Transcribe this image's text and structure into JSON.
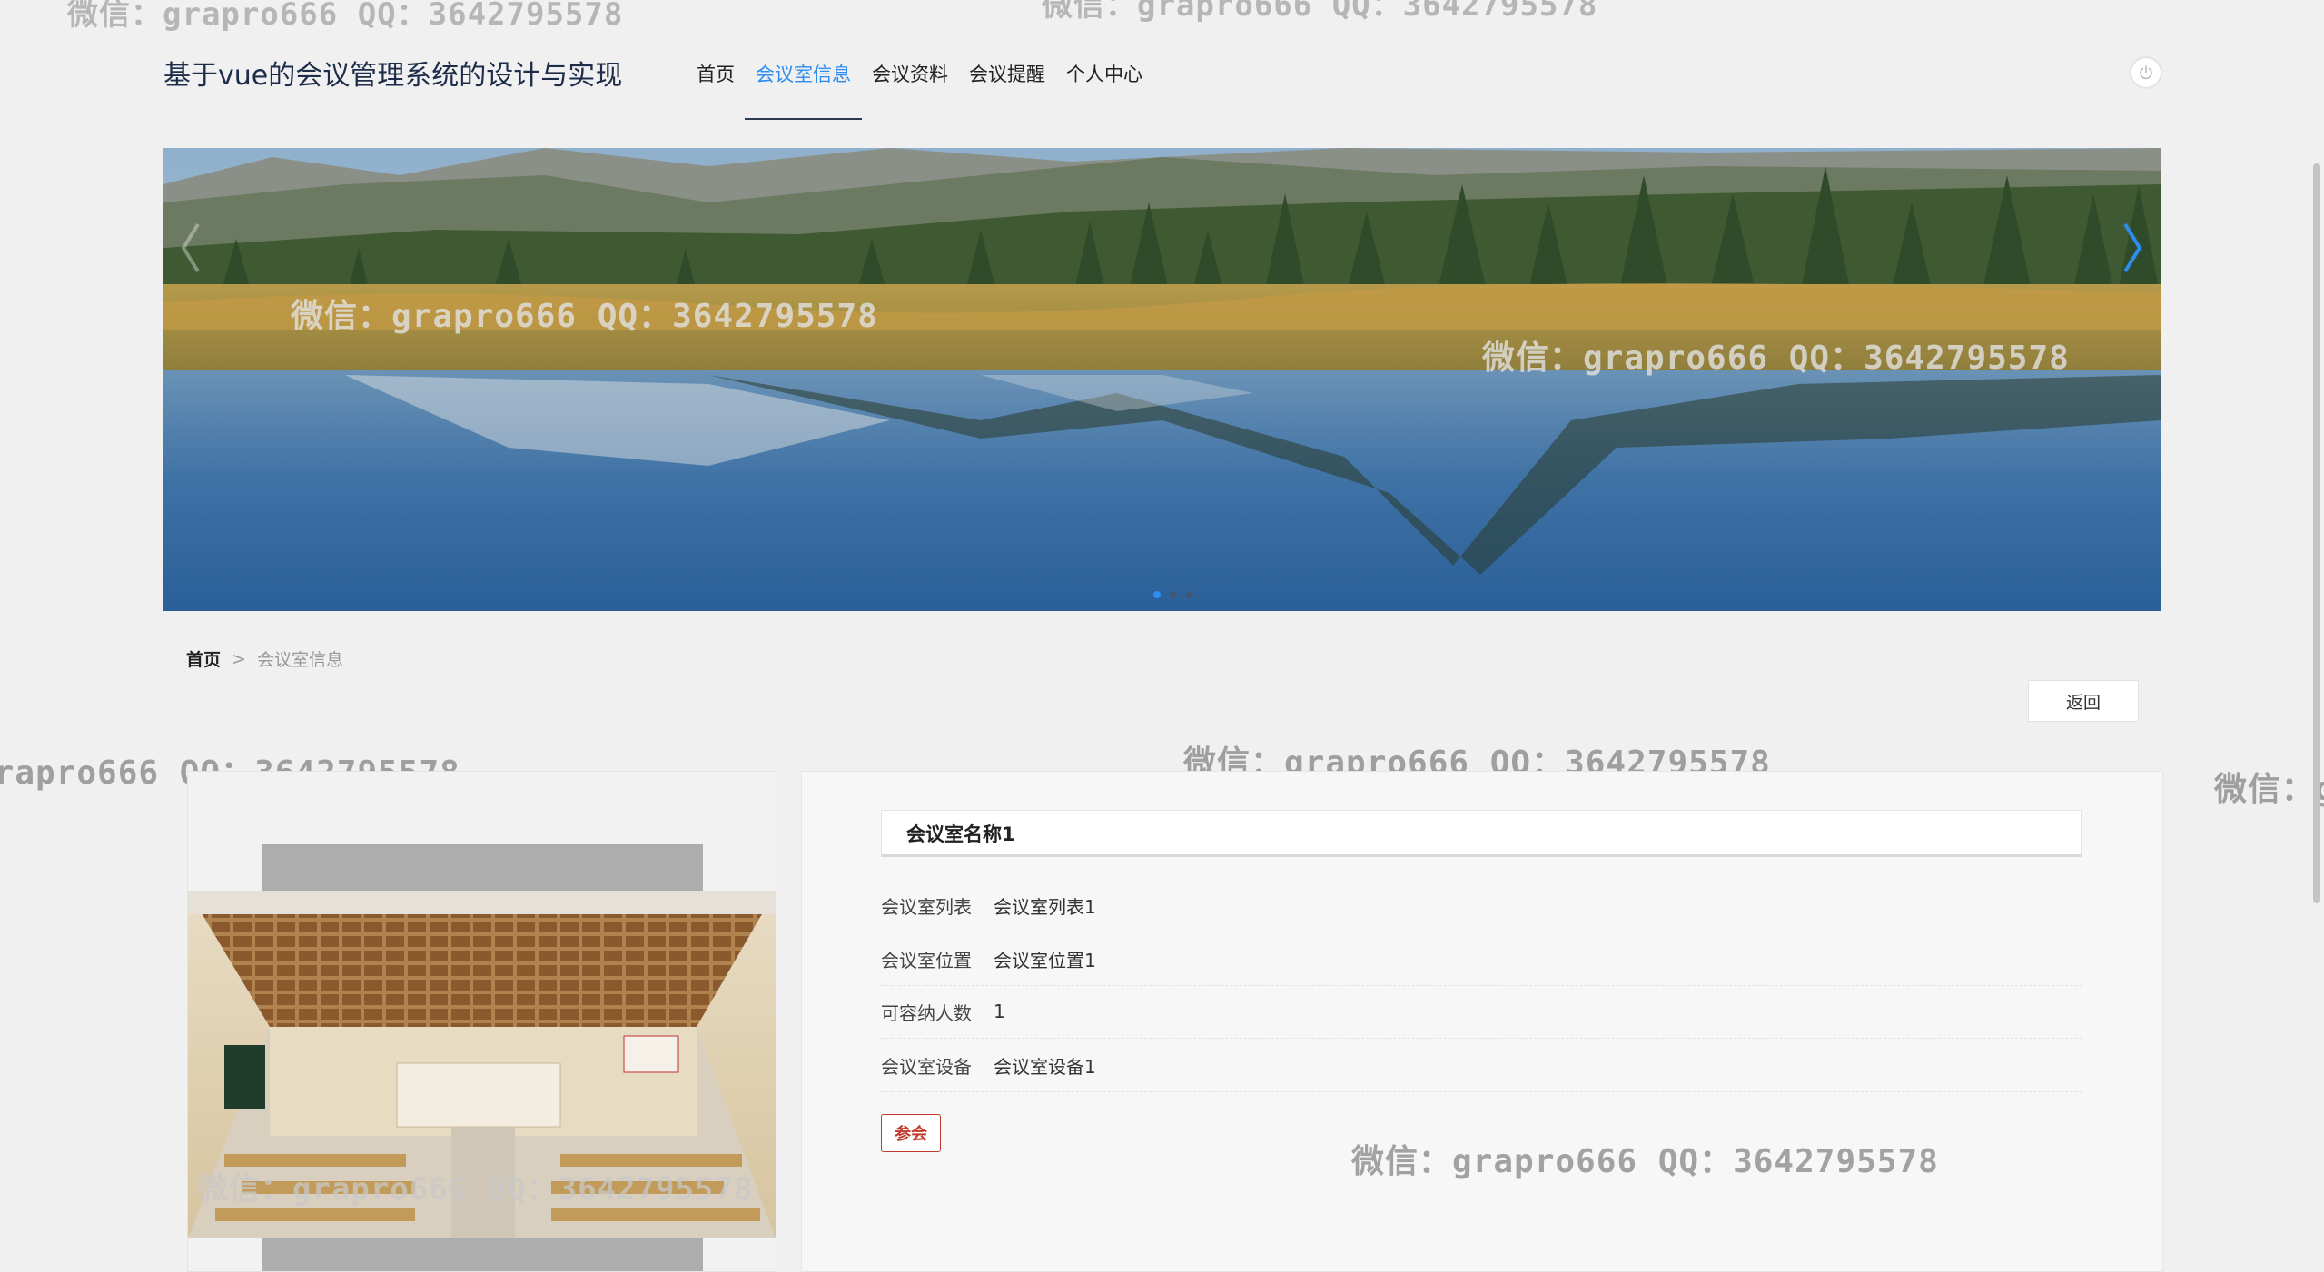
{
  "site": {
    "title": "基于vue的会议管理系统的设计与实现"
  },
  "nav": {
    "items": [
      "首页",
      "会议室信息",
      "会议资料",
      "会议提醒",
      "个人中心"
    ],
    "active_index": 1
  },
  "banner": {
    "slide_count": 3,
    "active_slide": 0
  },
  "breadcrumb": {
    "home": "首页",
    "separator": ">",
    "current": "会议室信息"
  },
  "actions": {
    "back_label": "返回",
    "join_label": "参会"
  },
  "detail": {
    "name": "会议室名称1",
    "fields": [
      {
        "label": "会议室列表",
        "value": "会议室列表1"
      },
      {
        "label": "会议室位置",
        "value": "会议室位置1"
      },
      {
        "label": "可容纳人数",
        "value": "1"
      },
      {
        "label": "会议室设备",
        "value": "会议室设备1"
      }
    ]
  },
  "watermark": {
    "text": "微信：grapro666 QQ：3642795578"
  },
  "colors": {
    "accent": "#2d8cf0",
    "title": "#1e2d4a",
    "join_border": "#c0392b"
  }
}
